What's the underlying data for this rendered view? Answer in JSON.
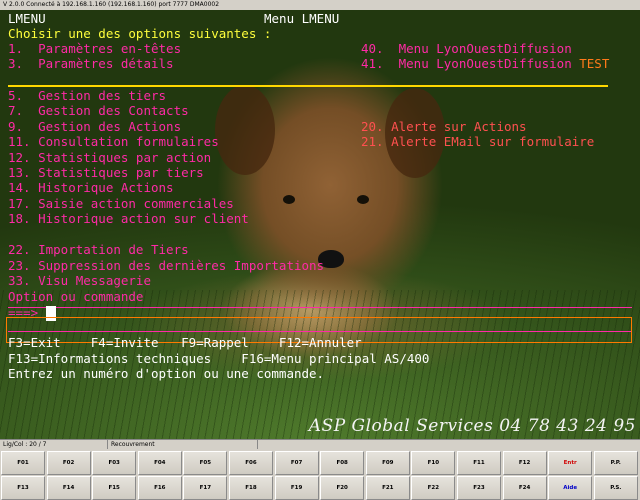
{
  "window": {
    "title": "V 2.0.0 Connecté à 192.168.1.160 (192.168.1.160) port 7777  DMA0002"
  },
  "terminal": {
    "header_left": "LMENU",
    "header_center": "Menu LMENU",
    "prompt": "Choisir une des options suivantes :",
    "options_left": [
      "1.  Paramètres en-têtes",
      "3.  Paramètres détails",
      "5.  Gestion des tiers",
      "7.  Gestion des Contacts",
      "9.  Gestion des Actions",
      "11. Consultation formulaires",
      "12. Statistiques par action",
      "13. Statistiques par tiers",
      "14. Historique Actions",
      "17. Saisie action commerciales",
      "18. Historique action sur client",
      "22. Importation de Tiers",
      "23. Suppression des dernières Importations",
      "33. Visu Messagerie"
    ],
    "options_right": [
      {
        "text": "40.  Menu LyonOuestDiffusion",
        "suffix": ""
      },
      {
        "text": "41.  Menu LyonOuestDiffusion",
        "suffix": "TEST"
      },
      {
        "text": "20. Alerte sur Actions",
        "suffix": ""
      },
      {
        "text": "21. Alerte EMail sur formulaire",
        "suffix": ""
      }
    ],
    "option_label": "Option ou commande",
    "arrow": "===>",
    "command_value": "",
    "fkeys_line1": "F3=Exit    F4=Invite   F9=Rappel    F12=Annuler",
    "fkeys_line2": "F13=Informations techniques    F16=Menu principal AS/400",
    "message": "Entrez un numéro d'option ou une commande.",
    "watermark": "ASP Global Services  04 78 43 24 95"
  },
  "statusbar": {
    "cursor": "Lig/Col : 20 / 7",
    "mode": "Recouvrement"
  },
  "fkeys_row1": [
    "F01",
    "F02",
    "F03",
    "F04",
    "F05",
    "F06",
    "F07",
    "F08",
    "F09",
    "F10",
    "F11",
    "F12",
    "Entr",
    "P.P."
  ],
  "fkeys_row2": [
    "F13",
    "F14",
    "F15",
    "F16",
    "F17",
    "F18",
    "F19",
    "F20",
    "F21",
    "F22",
    "F23",
    "F24",
    "Aide",
    "P.S."
  ],
  "colors": {
    "menu_text": "#ff2aa6",
    "header_text": "#ffffff",
    "key_text": "#ffff3c",
    "alert_text": "#ff5050",
    "test_text": "#ff7a1a"
  }
}
